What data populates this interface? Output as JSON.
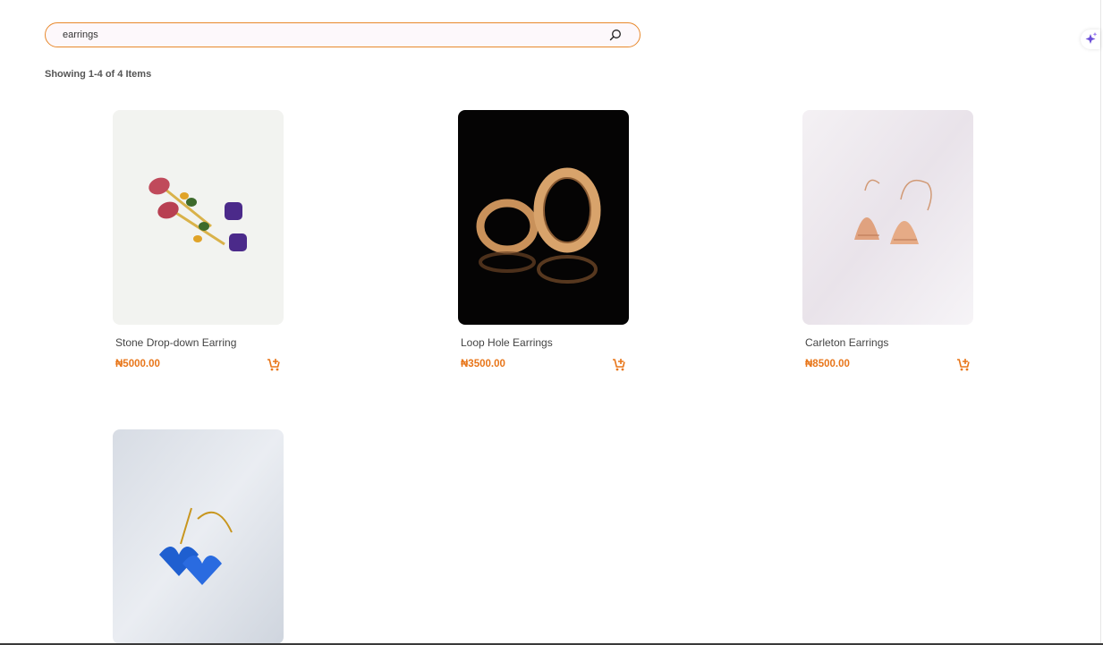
{
  "search": {
    "value": "earrings",
    "placeholder": "Search"
  },
  "results": {
    "summary": "Showing 1-4 of 4 Items"
  },
  "products": [
    {
      "name": "Stone Drop-down Earring",
      "price": "₦5000.00",
      "image_icon": "gemstone-drop-earring-image"
    },
    {
      "name": "Loop Hole Earrings",
      "price": "₦3500.00",
      "image_icon": "gold-hoop-earring-image"
    },
    {
      "name": "Carleton Earrings",
      "price": "₦8500.00",
      "image_icon": "rose-gold-bell-earring-image"
    },
    {
      "name": "",
      "price": "",
      "image_icon": "blue-heart-earring-image"
    }
  ],
  "icons": {
    "search": "search-icon",
    "cart": "add-to-cart-icon",
    "assistant": "sparkle-icon"
  },
  "colors": {
    "accent": "#e8761a",
    "search_border": "#e8892c"
  }
}
